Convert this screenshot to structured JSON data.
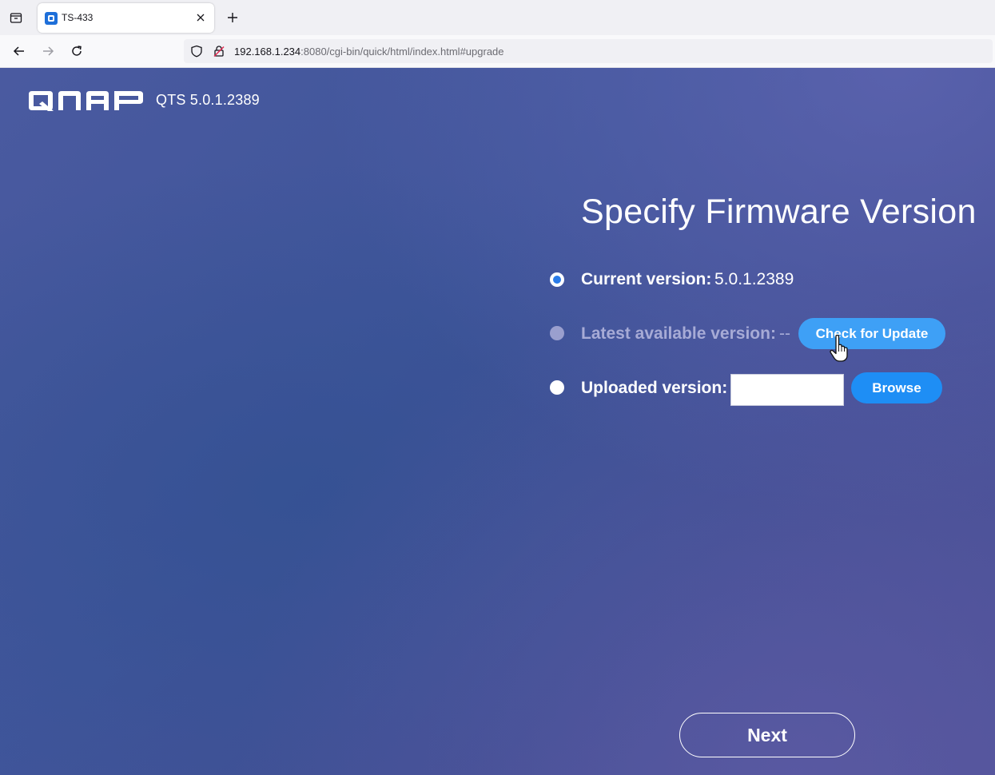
{
  "browser": {
    "tab_title": "TS-433",
    "url_host": "192.168.1.234",
    "url_rest": ":8080/cgi-bin/quick/html/index.html#upgrade"
  },
  "header": {
    "brand": "QNAP",
    "version": "QTS 5.0.1.2389"
  },
  "main": {
    "title": "Specify Firmware Version",
    "options": {
      "current": {
        "label": "Current version:",
        "value": "5.0.1.2389",
        "selected": true
      },
      "latest": {
        "label": "Latest available version:",
        "value": "--",
        "enabled": false,
        "button": "Check for Update"
      },
      "uploaded": {
        "label": "Uploaded version:",
        "value": "",
        "button": "Browse"
      }
    },
    "next_label": "Next"
  },
  "colors": {
    "accent": "#1e8ef5",
    "background": "#4153a0"
  }
}
